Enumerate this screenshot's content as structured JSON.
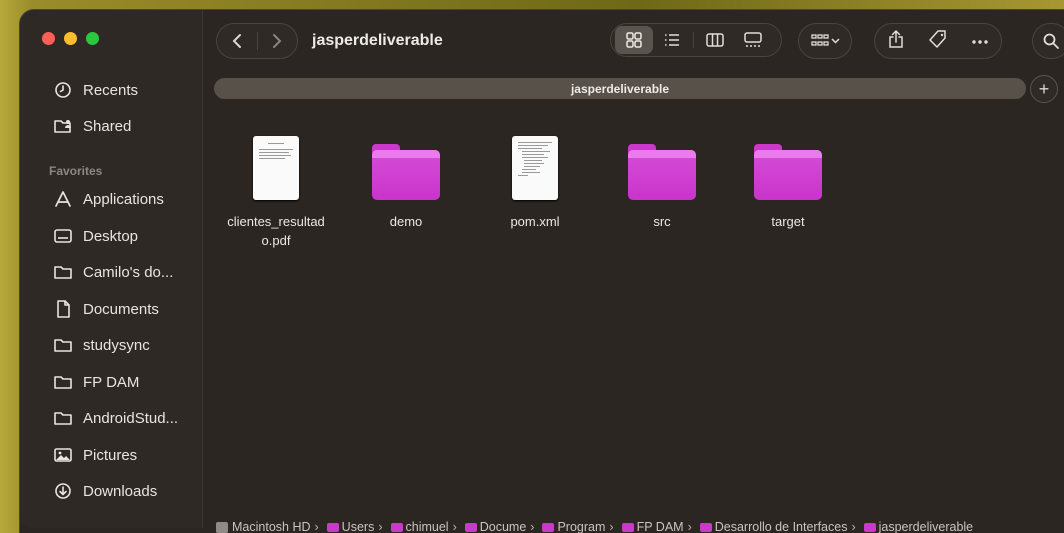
{
  "window": {
    "title": "jasperdeliverable"
  },
  "sidebar": {
    "items_top": [
      {
        "label": "Recents",
        "icon": "clock-icon"
      },
      {
        "label": "Shared",
        "icon": "shared-folder-icon"
      }
    ],
    "favorites_label": "Favorites",
    "favorites": [
      {
        "label": "Applications",
        "icon": "applications-icon"
      },
      {
        "label": "Desktop",
        "icon": "desktop-icon"
      },
      {
        "label": "Camilo's do...",
        "icon": "folder-icon"
      },
      {
        "label": "Documents",
        "icon": "document-icon"
      },
      {
        "label": "studysync",
        "icon": "folder-icon"
      },
      {
        "label": "FP DAM",
        "icon": "folder-icon"
      },
      {
        "label": "AndroidStud...",
        "icon": "folder-icon"
      },
      {
        "label": "Pictures",
        "icon": "pictures-icon"
      },
      {
        "label": "Downloads",
        "icon": "download-icon"
      }
    ]
  },
  "tab": {
    "label": "jasperdeliverable"
  },
  "files": [
    {
      "name": "clientes_resultad\no.pdf",
      "kind": "pdf"
    },
    {
      "name": "demo",
      "kind": "folder"
    },
    {
      "name": "pom.xml",
      "kind": "xml"
    },
    {
      "name": "src",
      "kind": "folder"
    },
    {
      "name": "target",
      "kind": "folder"
    }
  ],
  "pathbar": {
    "root": "Macintosh HD",
    "crumbs": [
      "Users",
      "chimuel",
      "Docume",
      "Program",
      "FP DAM",
      "Desarrollo de Interfaces",
      "jasperdeliverable"
    ]
  },
  "colors": {
    "folder": "#c934cb",
    "window": "#2b2622"
  }
}
